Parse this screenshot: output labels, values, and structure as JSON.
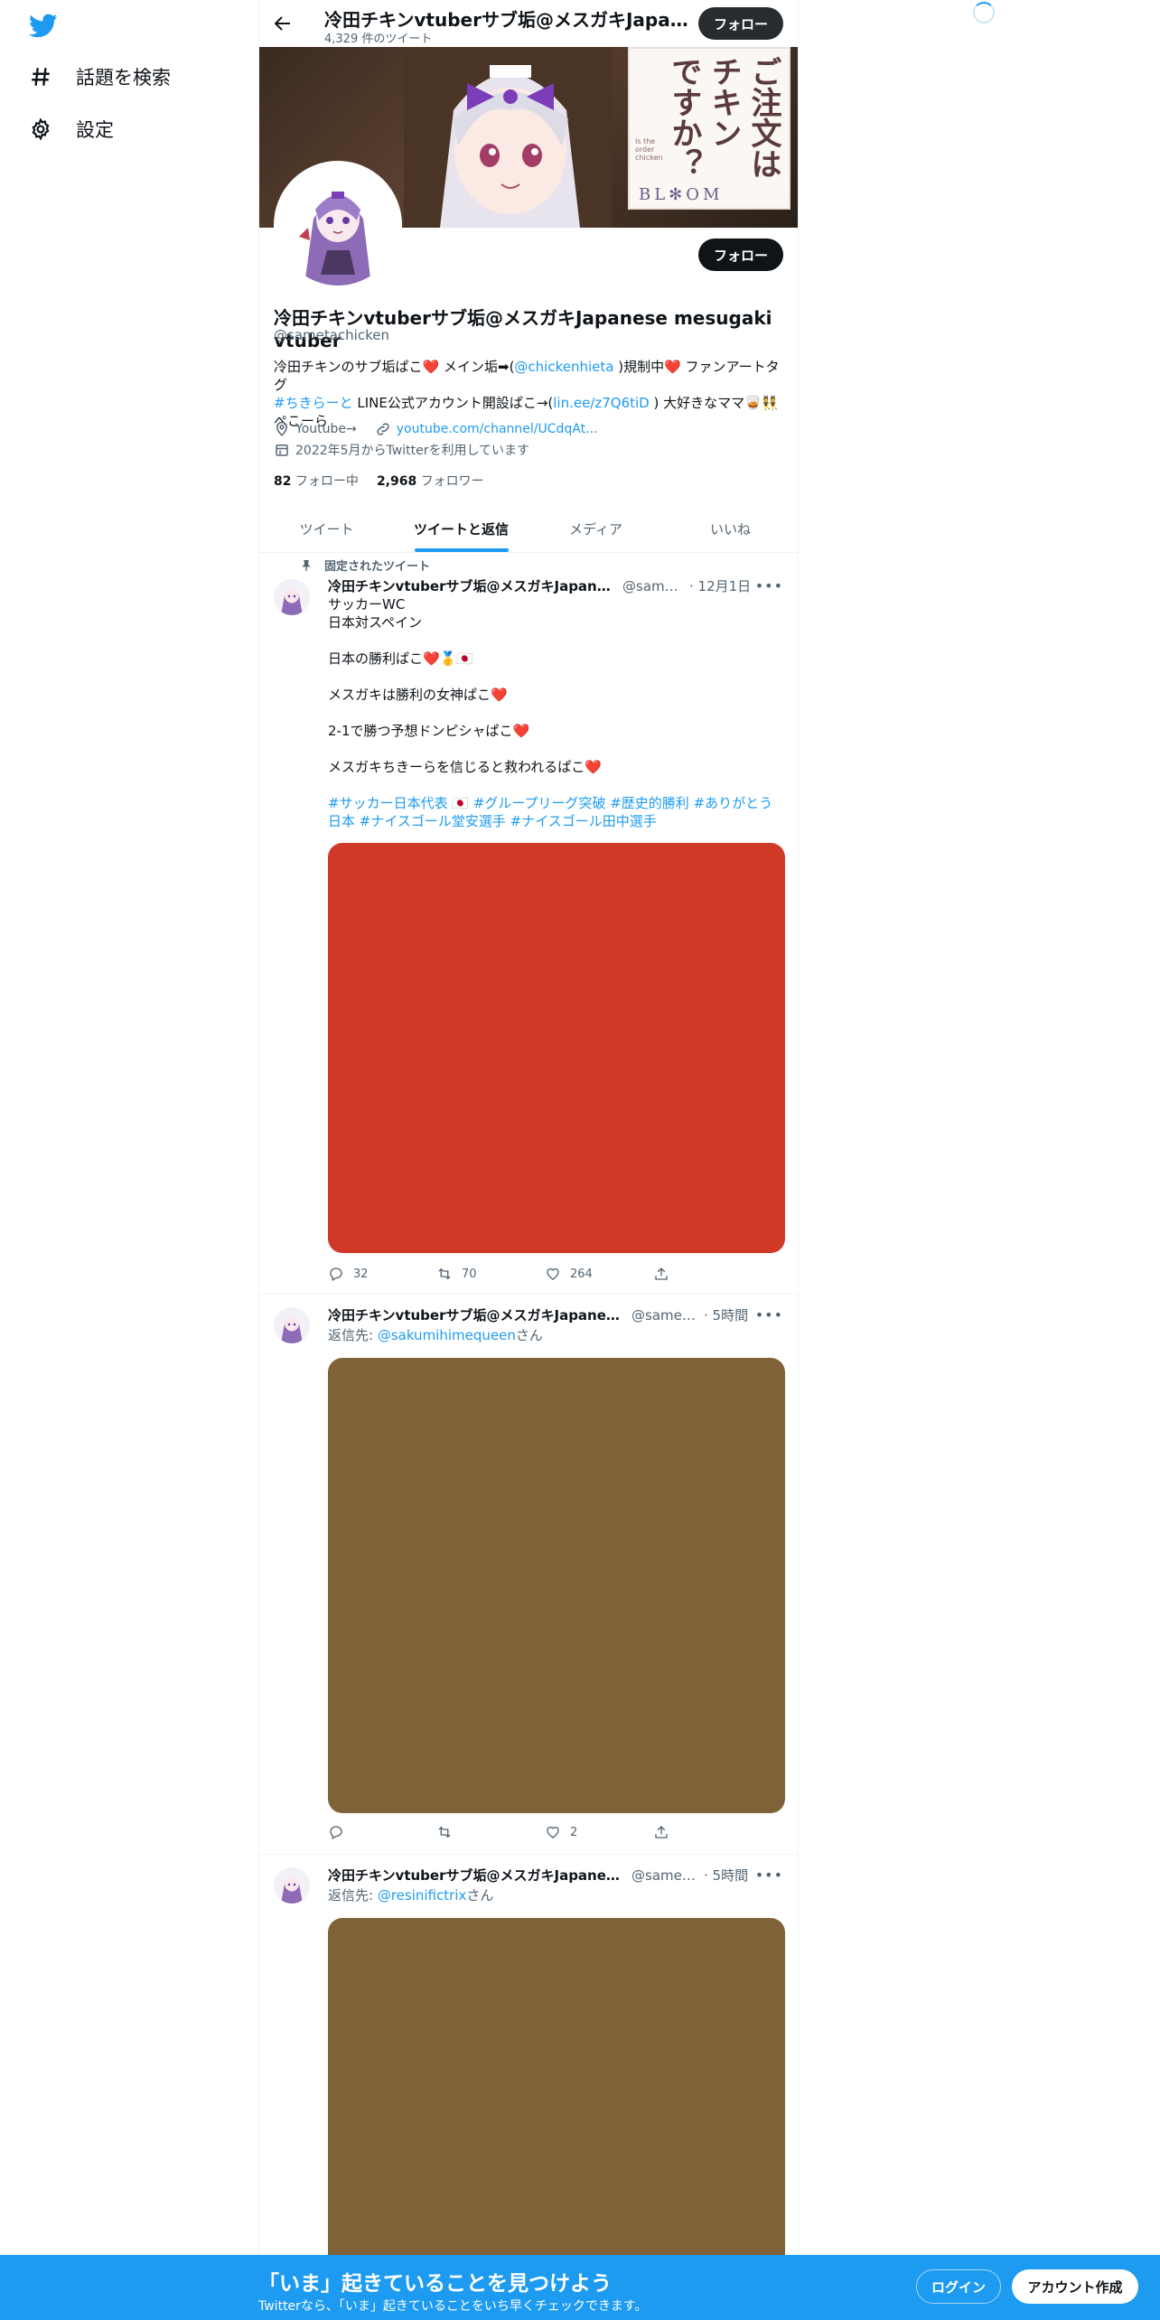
{
  "nav": {
    "explore_label": "話題を検索",
    "settings_label": "設定"
  },
  "topbar": {
    "title": "冷田チキンvtuberサブ垢@メスガキJapanese mesugaki vtuber",
    "tweet_count": "4,329 件のツイート",
    "follow_label": "フォロー"
  },
  "banner": {
    "card_line1": "ご注文は",
    "card_line2": "チキン",
    "card_line3": "ですか？",
    "card_footer": "BL✻OM",
    "card_sub": "Is the order chicken"
  },
  "profile": {
    "name": "冷田チキンvtuberサブ垢@メスガキJapanese mesugaki vtuber",
    "handle": "@sametachicken",
    "follow_label": "フォロー",
    "bio": {
      "p1": "冷田チキンのサブ垢ぱこ❤️ メイン垢➡(",
      "mention": "@chickenhieta",
      "p2": " )規制中❤️ ファンアートタグ",
      "hashtag": "#ちきらーと",
      "p3": " LINE公式アカウント開設ぱこ→(",
      "link": "lin.ee/z7Q6tiD",
      "p4": " ) 大好きなママ🥃👯",
      "p5": "ぺこーら"
    },
    "location": "Youtube→",
    "website": "youtube.com/channel/UCdqAt...",
    "joined": "2022年5月からTwitterを利用しています",
    "following_count": "82",
    "following_label": "フォロー中",
    "followers_count": "2,968",
    "followers_label": "フォロワー"
  },
  "tabs": [
    "ツイート",
    "ツイートと返信",
    "メディア",
    "いいね"
  ],
  "tweets": [
    {
      "pinned_label": "固定されたツイート",
      "name": "冷田チキンvtuberサブ垢@メスガキJapanese mesugaki vtuber",
      "handle": "@sametachicken",
      "time": "12月1日",
      "lines": [
        "サッカーWC",
        "日本対スペイン",
        "",
        "日本の勝利ぱこ❤️🥇🇯🇵",
        "",
        "メスガキは勝利の女神ぱこ❤️",
        "",
        "2-1で勝つ予想ドンピシャぱこ❤️",
        "",
        "メスガキちきーらを信じると救われるぱこ❤️"
      ],
      "hashtags": "#サッカー日本代表 🇯🇵 #グループリーグ突破 #歴史的勝利 #ありがとう日本 #ナイスゴール堂安選手 #ナイスゴール田中選手",
      "media_color": "#d03828",
      "replies": "32",
      "retweets": "70",
      "likes": "264"
    },
    {
      "name": "冷田チキンvtuberサブ垢@メスガキJapanese mesugaki vtuber",
      "handle": "@sametachicken",
      "time": "5時間",
      "reply_prefix": "返信先: ",
      "reply_to": "@sakumihimequeen",
      "reply_suffix": "さん",
      "media_color": "#7f6238",
      "replies": "",
      "retweets": "",
      "likes": "2"
    },
    {
      "name": "冷田チキンvtuberサブ垢@メスガキJapanese mesugaki vtuber",
      "handle": "@sametachicken",
      "time": "5時間",
      "reply_prefix": "返信先: ",
      "reply_to": "@resinifictrix",
      "reply_suffix": "さん",
      "media_color": "#7f6238"
    }
  ],
  "bottom": {
    "title": "「いま」起きていることを見つけよう",
    "subtitle": "Twitterなら、「いま」起きていることをいち早くチェックできます。",
    "login": "ログイン",
    "signup": "アカウント作成"
  },
  "colors": {
    "accent": "#1d9bf0",
    "text": "#0f1419",
    "muted": "#536471"
  }
}
